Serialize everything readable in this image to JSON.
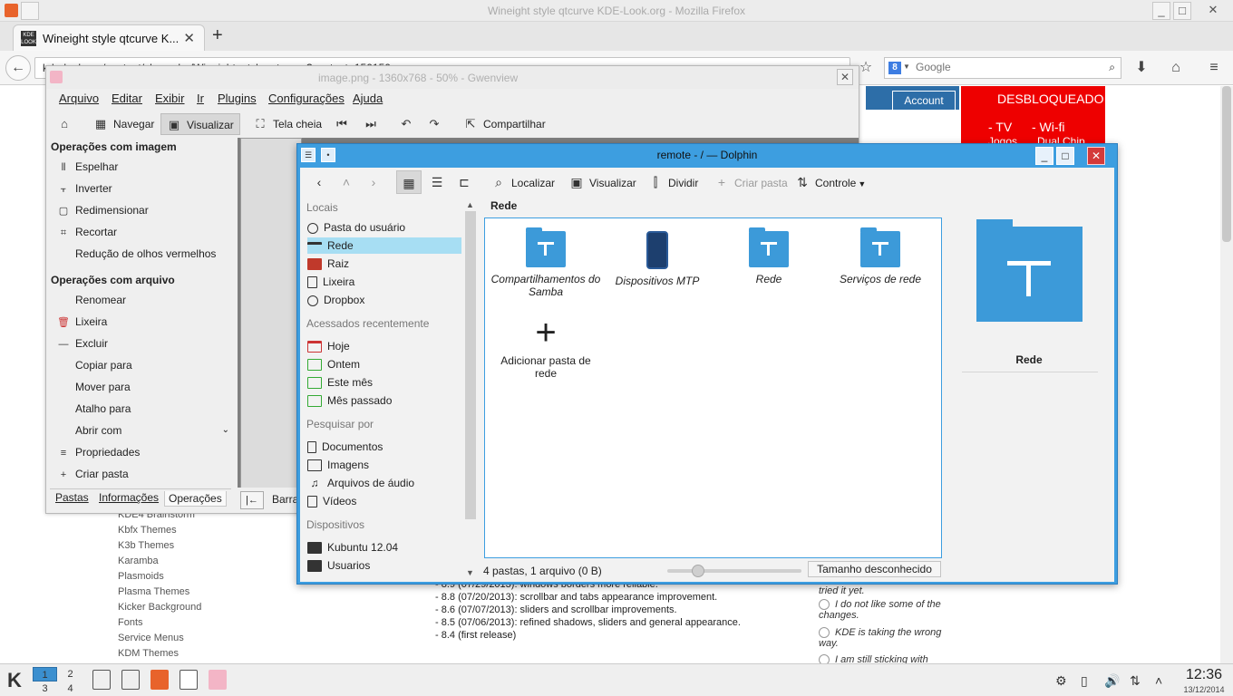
{
  "firefox": {
    "window_title": "Wineight style qtcurve KDE-Look.org - Mozilla Firefox",
    "tab_title": "Wineight style qtcurve K...",
    "tab_favicon_text": "KDE LOOK",
    "url": "kde-look.org/content/show.php/Wineight+style+qtcurve?content=150150",
    "search_placeholder": "Google"
  },
  "website": {
    "account_label": "Account",
    "promo": {
      "line1": "DESBLOQUEADO",
      "line2": "- TV",
      "line3": "- Wi-fi",
      "line4": "Jogos",
      "line5": "Dual Chip"
    },
    "categories": [
      "KDE4 Brainstorm",
      "Kbfx Themes",
      "K3b Themes",
      "Karamba",
      "Plasmoids",
      "Plasma Themes",
      "Kicker Background",
      "Fonts",
      "Service Menus",
      "KDM Themes"
    ],
    "changelog": [
      "- 8.9 (07/29/2013): windows borders more reliable.",
      "- 8.8 (07/20/2013): scrollbar and tabs appearance improvement.",
      "- 8.6 (07/07/2013): sliders and scrollbar improvements.",
      "- 8.5 (07/06/2013): refined shadows, sliders and general appearance.",
      "- 8.4 (first release)"
    ],
    "poll": {
      "prev": "tried it yet.",
      "option1": "I do not like some of the changes.",
      "option2": "KDE is taking the wrong way.",
      "option3": "I am still sticking with"
    }
  },
  "gwenview": {
    "window_title": "image.png - 1360x768 - 50% - Gwenview",
    "menus": [
      "Arquivo",
      "Editar",
      "Exibir",
      "Ir",
      "Plugins",
      "Configurações",
      "Ajuda"
    ],
    "toolbar": {
      "navegar": "Navegar",
      "visualizar": "Visualizar",
      "tela_cheia": "Tela cheia",
      "compartilhar": "Compartilhar"
    },
    "image_ops_title": "Operações com imagem",
    "image_ops": [
      "Espelhar",
      "Inverter",
      "Redimensionar",
      "Recortar",
      "Redução de olhos vermelhos"
    ],
    "file_ops_title": "Operações com arquivo",
    "file_ops": [
      "Renomear",
      "Lixeira",
      "Excluir",
      "Copiar para",
      "Mover para",
      "Atalho para",
      "Abrir com",
      "Propriedades",
      "Criar pasta"
    ],
    "tabs": [
      "Pastas",
      "Informações",
      "Operações"
    ],
    "status_bar_label": "Barra"
  },
  "dolphin": {
    "window_title": "remote - / — Dolphin",
    "toolbar": {
      "localizar": "Localizar",
      "visualizar": "Visualizar",
      "dividir": "Dividir",
      "criar_pasta": "Criar pasta",
      "controle": "Controle"
    },
    "places_sections": {
      "locais": "Locais",
      "recentes": "Acessados recentemente",
      "pesquisar": "Pesquisar por",
      "dispositivos": "Dispositivos"
    },
    "places": {
      "locais": [
        "Pasta do usuário",
        "Rede",
        "Raiz",
        "Lixeira",
        "Dropbox"
      ],
      "recentes": [
        "Hoje",
        "Ontem",
        "Este mês",
        "Mês passado"
      ],
      "pesquisar": [
        "Documentos",
        "Imagens",
        "Arquivos de áudio",
        "Vídeos"
      ],
      "dispositivos": [
        "Kubuntu 12.04",
        "Usuarios"
      ]
    },
    "breadcrumb": "Rede",
    "items": [
      "Compartilhamentos do Samba",
      "Dispositivos MTP",
      "Rede",
      "Serviços de rede"
    ],
    "add_folder": "Adicionar pasta de rede",
    "info_name": "Rede",
    "status_text": "4 pastas, 1 arquivo (0 B)",
    "space_label": "Tamanho desconhecido",
    "zoom_fraction": 0.2
  },
  "taskbar": {
    "desktops": [
      "1",
      "2",
      "3",
      "4"
    ],
    "time": "12:36",
    "date": "13/12/2014"
  },
  "colors": {
    "accent": "#3d9ee0",
    "selection": "#a7def3",
    "promo": "#ee0000",
    "account": "#2d6ea8"
  }
}
